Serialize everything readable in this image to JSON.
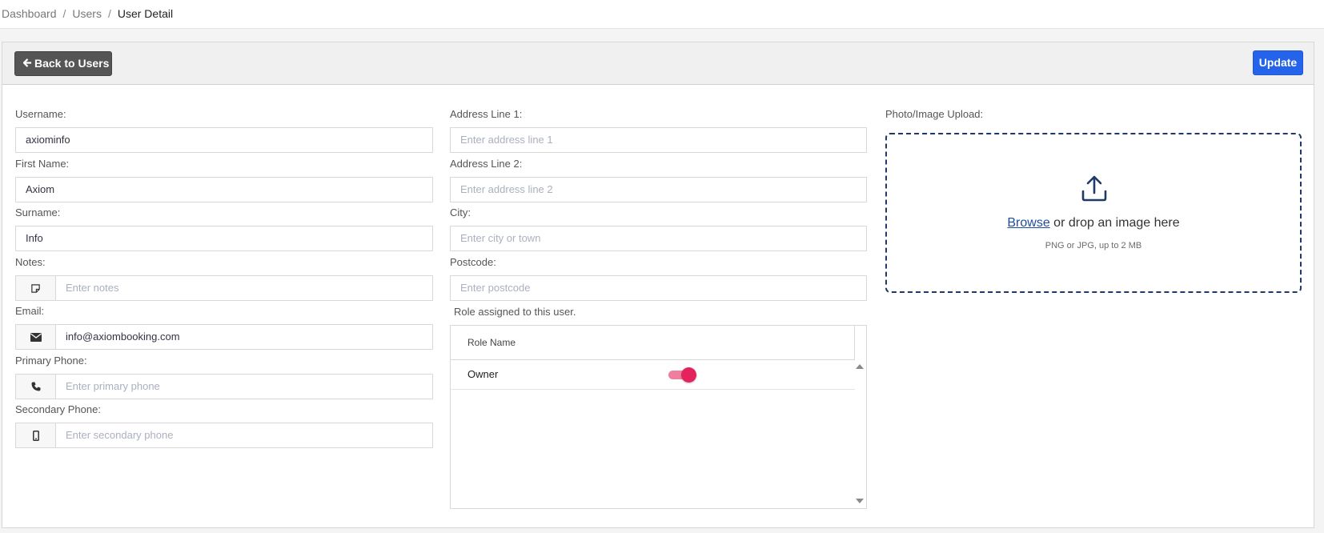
{
  "breadcrumb": {
    "items": [
      "Dashboard",
      "Users"
    ],
    "current": "User Detail",
    "separator": "/"
  },
  "header": {
    "back_label": "Back to Users",
    "update_label": "Update"
  },
  "form": {
    "username": {
      "label": "Username:",
      "value": "axiominfo"
    },
    "first_name": {
      "label": "First Name:",
      "value": "Axiom"
    },
    "surname": {
      "label": "Surname:",
      "value": "Info"
    },
    "notes": {
      "label": "Notes:",
      "placeholder": "Enter notes"
    },
    "email": {
      "label": "Email:",
      "value": "info@axiombooking.com"
    },
    "primary_phone": {
      "label": "Primary Phone:",
      "placeholder": "Enter primary phone"
    },
    "secondary_phone": {
      "label": "Secondary Phone:",
      "placeholder": "Enter secondary phone"
    },
    "address1": {
      "label": "Address Line 1:",
      "placeholder": "Enter address line 1"
    },
    "address2": {
      "label": "Address Line 2:",
      "placeholder": "Enter address line 2"
    },
    "city": {
      "label": "City:",
      "placeholder": "Enter city or town"
    },
    "postcode": {
      "label": "Postcode:",
      "placeholder": "Enter postcode"
    }
  },
  "roles": {
    "caption": "Role assigned to this user.",
    "column_header": "Role Name",
    "rows": [
      {
        "name": "Owner",
        "enabled": true
      }
    ]
  },
  "upload": {
    "label": "Photo/Image Upload:",
    "browse": "Browse",
    "text_rest": " or drop an image here",
    "hint": "PNG or JPG, up to 2 MB"
  },
  "colors": {
    "primary": "#2563eb",
    "back_button": "#555555",
    "toggle_on": "#e4225c",
    "upload_border": "#1f3a64"
  },
  "icons": {
    "notes": "sticky-note-icon",
    "email": "envelope-icon",
    "primary_phone": "phone-icon",
    "secondary_phone": "mobile-icon",
    "upload": "upload-icon",
    "back": "arrow-left-icon"
  }
}
